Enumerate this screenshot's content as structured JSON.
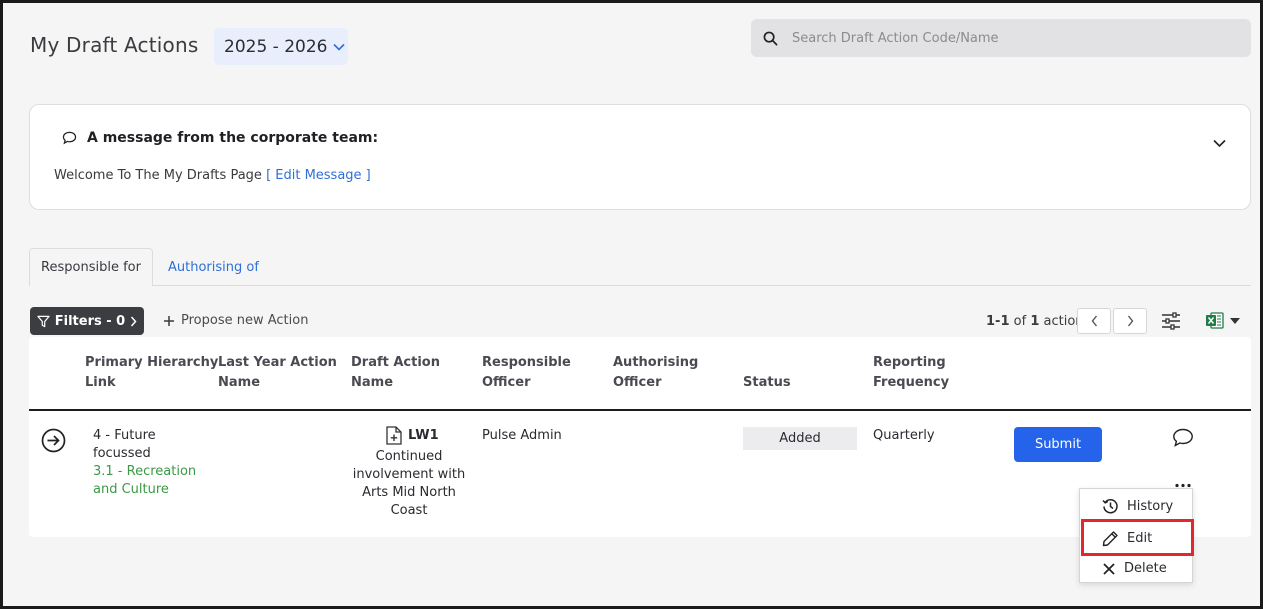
{
  "header": {
    "title": "My Draft Actions",
    "year": "2025 - 2026",
    "search_placeholder": "Search Draft Action Code/Name"
  },
  "message": {
    "title": "A message from the corporate team:",
    "body": "Welcome To The My Drafts Page",
    "edit_link": "[ Edit Message ]"
  },
  "tabs": [
    {
      "label": "Responsible for",
      "active": true
    },
    {
      "label": "Authorising of",
      "active": false
    }
  ],
  "toolbar": {
    "filters_label": "Filters - 0",
    "propose_label": "Propose new Action",
    "pager_range": "1-1",
    "pager_of": "of",
    "pager_total": "1",
    "pager_unit": "action"
  },
  "table": {
    "headers": {
      "primary_hierarchy": [
        "Primary Hierarchy",
        "Link"
      ],
      "last_year": [
        "Last Year Action",
        "Name"
      ],
      "draft_action": [
        "Draft Action",
        "Name"
      ],
      "responsible": [
        "Responsible",
        "Officer"
      ],
      "authorising": [
        "Authorising",
        "Officer"
      ],
      "status": "Status",
      "reporting": [
        "Reporting",
        "Frequency"
      ]
    },
    "row": {
      "hierarchy_main": [
        "4 - Future",
        "focussed"
      ],
      "hierarchy_sub": [
        "3.1 - Recreation",
        "and Culture"
      ],
      "draft_code": "LW1",
      "draft_name": [
        "Continued",
        "involvement with",
        "Arts Mid North",
        "Coast"
      ],
      "responsible_officer": "Pulse Admin",
      "status": "Added",
      "reporting_frequency": "Quarterly",
      "submit_label": "Submit"
    }
  },
  "context_menu": {
    "items": [
      {
        "label": "History",
        "icon": "history-icon"
      },
      {
        "label": "Edit",
        "icon": "pencil-icon"
      },
      {
        "label": "Delete",
        "icon": "close-icon"
      }
    ]
  },
  "colors": {
    "accent": "#2563eb",
    "link": "#2f6fd6",
    "green": "#3b9a45",
    "highlight": "#e0282e",
    "excel": "#1e7d45"
  }
}
